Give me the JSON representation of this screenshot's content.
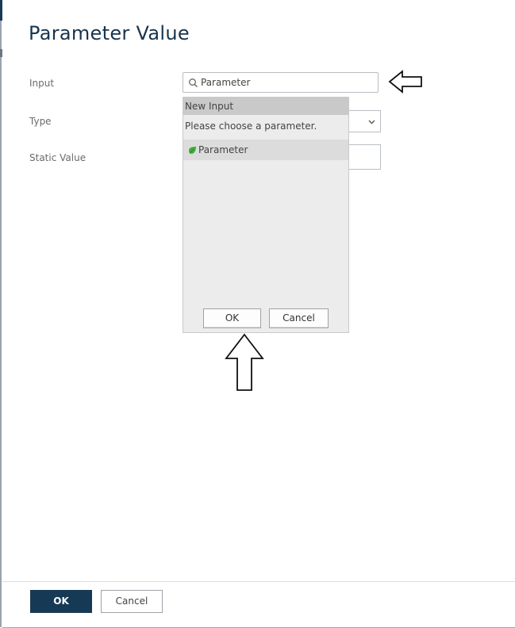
{
  "dialog": {
    "title": "Parameter Value"
  },
  "form": {
    "input_label": "Input",
    "type_label": "Type",
    "static_value_label": "Static Value",
    "search_value": "Parameter"
  },
  "dropdown": {
    "new_input": "New Input",
    "hint": "Please choose a parameter.",
    "items": [
      {
        "label": "Parameter",
        "icon": "green-leaf-icon"
      }
    ],
    "ok_label": "OK",
    "cancel_label": "Cancel"
  },
  "footer": {
    "ok_label": "OK",
    "cancel_label": "Cancel"
  },
  "colors": {
    "primary": "#163a56",
    "title": "#17344c",
    "leaf": "#3fae3a"
  }
}
